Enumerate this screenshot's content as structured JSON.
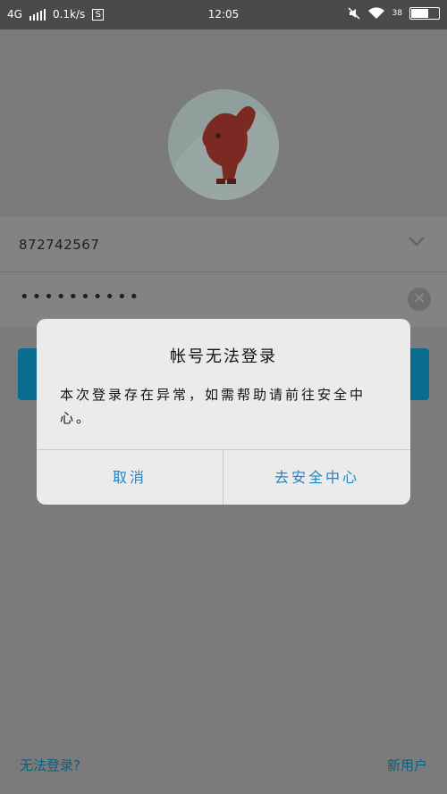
{
  "status": {
    "network": "4G",
    "speed": "0.1k/s",
    "s_icon": "S",
    "time": "12:05",
    "battery": "38"
  },
  "login": {
    "account": "872742567",
    "password_mask": "••••••••••",
    "cant_login": "无法登录?",
    "new_user": "新用户"
  },
  "dialog": {
    "title": "帐号无法登录",
    "message": "本次登录存在异常，如需帮助请前往安全中心。",
    "cancel": "取消",
    "go": "去安全中心"
  },
  "colors": {
    "accent": "#1f86c6",
    "overlay": "#7b7b7b",
    "dialog_bg": "#ebebeb"
  }
}
